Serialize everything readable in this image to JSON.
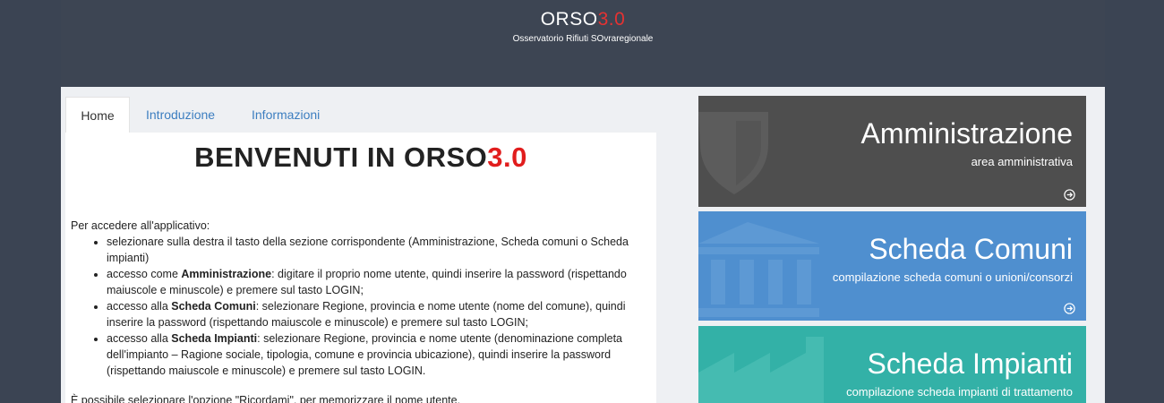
{
  "header": {
    "logo_name": "ORSO",
    "logo_version": "3.0",
    "subtitle": "Osservatorio Rifiuti SOvraregionale"
  },
  "tabs": [
    {
      "label": "Home",
      "active": true
    },
    {
      "label": "Introduzione",
      "active": false
    },
    {
      "label": "Informazioni",
      "active": false
    }
  ],
  "welcome": {
    "prefix": "BENVENUTI IN ORSO",
    "version": "3.0"
  },
  "intro": "Per accedere all'applicativo:",
  "steps": [
    {
      "before": "selezionare sulla destra il tasto della sezione corrispondente (Amministrazione, Scheda comuni o Scheda impianti)",
      "bold": "",
      "after": ""
    },
    {
      "before": "accesso come ",
      "bold": "Amministrazione",
      "after": ": digitare il proprio nome utente, quindi inserire la password (rispettando maiuscole e minuscole) e premere sul tasto LOGIN;"
    },
    {
      "before": "accesso alla ",
      "bold": "Scheda Comuni",
      "after": ": selezionare Regione, provincia e nome utente (nome del comune), quindi inserire la password (rispettando maiuscole e minuscole) e premere sul tasto LOGIN;"
    },
    {
      "before": "accesso alla ",
      "bold": "Scheda Impianti",
      "after": ": selezionare Regione, provincia e nome utente (denominazione completa dell'impianto – Ragione sociale, tipologia, comune e provincia ubicazione), quindi inserire la password (rispettando maiuscole e minuscole) e premere sul tasto LOGIN."
    }
  ],
  "footer_text": "È possibile selezionare l'opzione \"Ricordami\", per memorizzare il nome utente.",
  "tiles": [
    {
      "title": "Amministrazione",
      "subtitle": "area amministrativa",
      "color": "#4e4e4e",
      "icon": "shield-icon"
    },
    {
      "title": "Scheda Comuni",
      "subtitle": "compilazione scheda comuni o unioni/consorzi",
      "color": "#4f8fcf",
      "icon": "bank-icon"
    },
    {
      "title": "Scheda Impianti",
      "subtitle": "compilazione scheda impianti di trattamento",
      "color": "#33b1a7",
      "icon": "factory-icon"
    }
  ]
}
